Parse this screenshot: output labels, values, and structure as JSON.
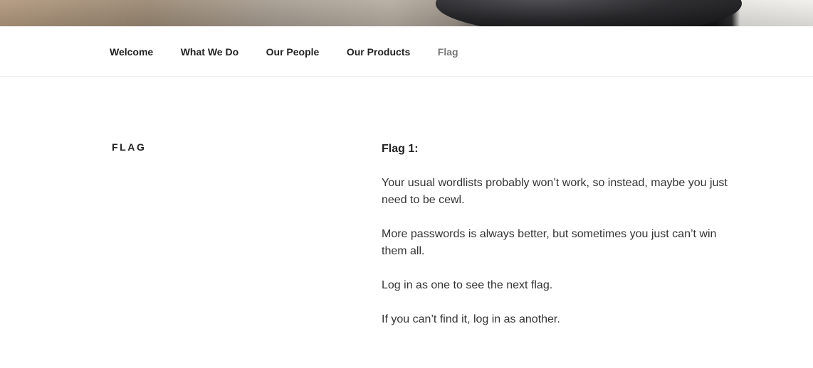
{
  "nav": {
    "items": [
      {
        "label": "Welcome"
      },
      {
        "label": "What We Do"
      },
      {
        "label": "Our People"
      },
      {
        "label": "Our Products"
      },
      {
        "label": "Flag",
        "current": true
      }
    ]
  },
  "page": {
    "title": "FLAG"
  },
  "content": {
    "heading": "Flag 1:",
    "paragraphs": [
      "Your usual wordlists probably won’t work, so instead, maybe you just need to be cewl.",
      "More passwords is always better, but sometimes you just can’t win them all.",
      "Log in as one to see the next flag.",
      "If you can’t find it, log in as another."
    ]
  },
  "colors": {
    "text": "#333333",
    "nav_text": "#222222",
    "nav_current": "#767676",
    "border": "#eeeeee"
  }
}
